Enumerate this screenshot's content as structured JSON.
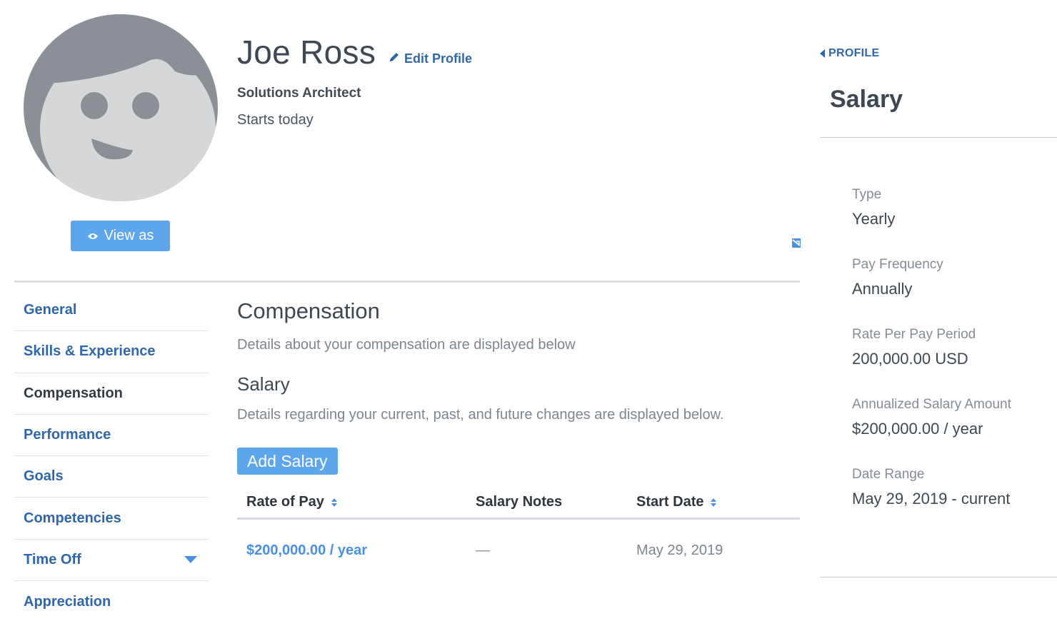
{
  "profile": {
    "name": "Joe Ross",
    "edit_label": "Edit Profile",
    "job_title": "Solutions Architect",
    "start_info": "Starts today",
    "view_as_label": "View as"
  },
  "sidebar": {
    "items": [
      {
        "label": "General",
        "active": false
      },
      {
        "label": "Skills & Experience",
        "active": false
      },
      {
        "label": "Compensation",
        "active": true
      },
      {
        "label": "Performance",
        "active": false
      },
      {
        "label": "Goals",
        "active": false
      },
      {
        "label": "Competencies",
        "active": false
      },
      {
        "label": "Time Off",
        "active": false
      },
      {
        "label": "Appreciation",
        "active": false
      }
    ]
  },
  "main": {
    "title": "Compensation",
    "description": "Details about your compensation are displayed below",
    "salary_title": "Salary",
    "salary_description": "Details regarding your current, past, and future changes are displayed below.",
    "add_salary_label": "Add Salary"
  },
  "table": {
    "headers": {
      "rate": "Rate of Pay",
      "notes": "Salary Notes",
      "start": "Start Date"
    },
    "rows": [
      {
        "rate": "$200,000.00 / year",
        "notes": "—",
        "start": "May 29, 2019"
      }
    ]
  },
  "panel": {
    "back_label": "PROFILE",
    "title": "Salary",
    "fields": [
      {
        "label": "Type",
        "value": "Yearly"
      },
      {
        "label": "Pay Frequency",
        "value": "Annually"
      },
      {
        "label": "Rate Per Pay Period",
        "value": "200,000.00 USD"
      },
      {
        "label": "Annualized Salary Amount",
        "value": "$200,000.00 / year"
      },
      {
        "label": "Date Range",
        "value": "May 29, 2019 - current"
      }
    ]
  },
  "colors": {
    "link": "#2f67aa",
    "primary_button": "#5ea6ec",
    "accent": "#4a90e2",
    "avatar_ring": "#8a9096",
    "avatar_face": "#d5d7d9"
  },
  "icons": {
    "edit": "pencil-icon",
    "view_as": "eye-icon",
    "collapse": "collapse-icon",
    "back": "caret-left-icon",
    "sort": "sort-icon",
    "dropdown": "caret-down-icon"
  }
}
